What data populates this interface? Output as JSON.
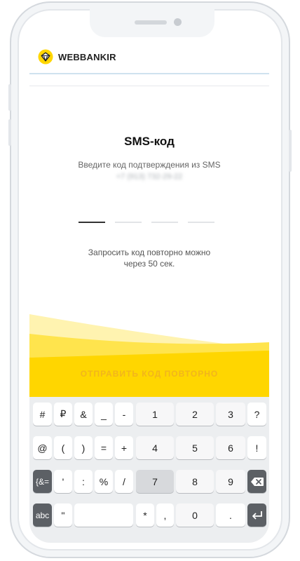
{
  "app": {
    "brand": "WEBBANKIR"
  },
  "sms": {
    "title": "SMS-код",
    "subtitle": "Введите код подтверждения из SMS",
    "phone_masked": "+7 (913) 732-29-22",
    "resend_info_line1": "Запросить код повторно можно",
    "resend_info_line2": "через 50 сек.",
    "resend_button": "ОТПРАВИТЬ КОД ПОВТОРНО"
  },
  "keyboard": {
    "row1": [
      "#",
      "₽",
      "&",
      "_",
      "-",
      "1",
      "2",
      "3",
      "?"
    ],
    "row2": [
      "@",
      "(",
      ")",
      "=",
      "+",
      "4",
      "5",
      "6",
      "!"
    ],
    "row3": [
      "{&=",
      "'",
      ":",
      "%",
      "/",
      "7",
      "8",
      "9",
      "backspace"
    ],
    "row4": [
      "abc",
      "\"",
      "space",
      "*",
      ",",
      "0",
      ".",
      "enter"
    ]
  },
  "colors": {
    "accent_yellow": "#ffd600",
    "resend_text": "#f2b51c"
  }
}
